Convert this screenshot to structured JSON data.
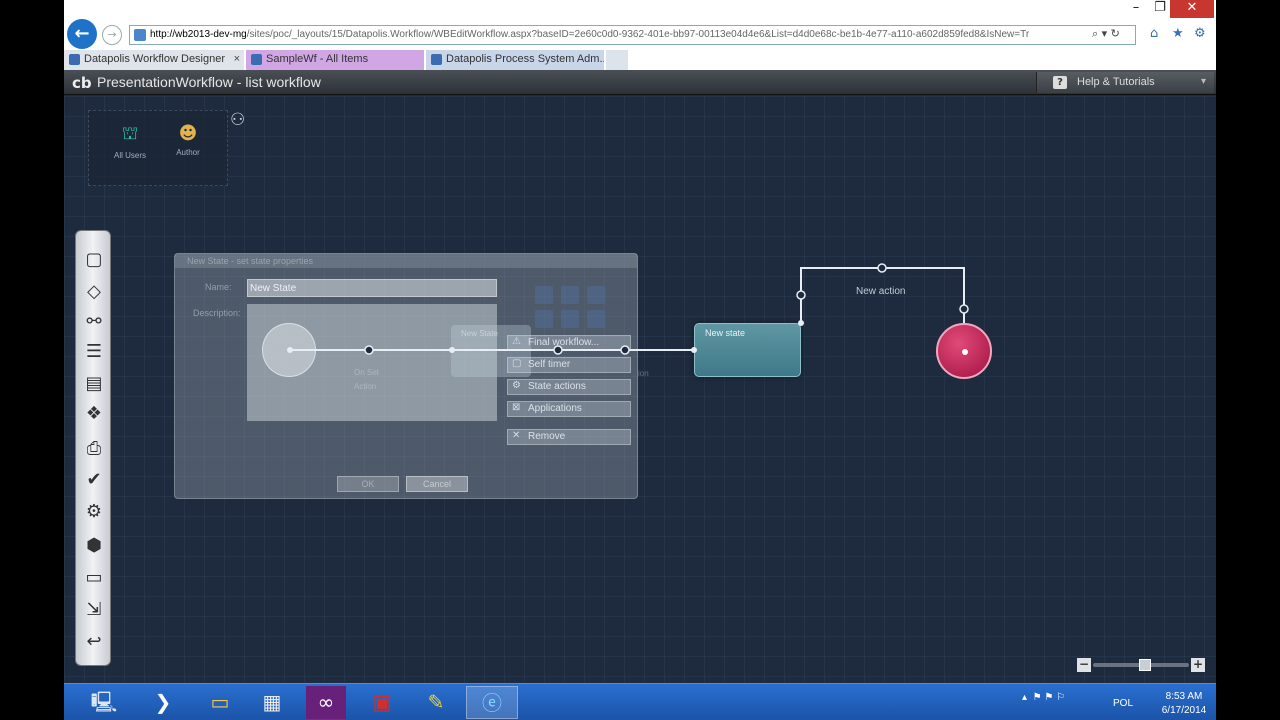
{
  "browser": {
    "address": {
      "host": "http://wb2013-dev-mg",
      "path": "/sites/poc/_layouts/15/Datapolis.Workflow/WBEditWorkflow.aspx?baseID=2e60c0d0-9362-401e-bb97-00113e04d4e6&List=d4d0e68c-be1b-4e77-a110-a602d859fed8&IsNew=Tr"
    },
    "tabs": [
      {
        "label": "Datapolis Workflow Designer",
        "close": "×"
      },
      {
        "label": "SampleWf - All Items"
      },
      {
        "label": "Datapolis Process System Adm..."
      }
    ],
    "window_buttons": {
      "minimize": "–",
      "restore": "❐",
      "close": "✕"
    }
  },
  "app": {
    "logo": "cb",
    "title": "PresentationWorkflow - list workflow",
    "help_button": "Help & Tutorials"
  },
  "roles": [
    {
      "label": "All Users",
      "icon": "users-icon"
    },
    {
      "label": "Author",
      "icon": "author-icon"
    }
  ],
  "toolbox": [
    "state-tool-icon",
    "decision-tool-icon",
    "connector-tool-icon",
    "list-tool-icon",
    "chart-tool-icon",
    "group-tool-icon",
    "print-tool-icon",
    "validate-tool-icon",
    "settings-tool-icon",
    "package-tool-icon",
    "save-tool-icon",
    "export-tool-icon",
    "undo-tool-icon"
  ],
  "dialog": {
    "title": "New State - set state properties",
    "name_label": "Name:",
    "name_value": "New State",
    "description_label": "Description:",
    "ok": "OK",
    "cancel": "Cancel"
  },
  "context_menu": [
    {
      "label": "Final workflow...",
      "icon": "final-icon"
    },
    {
      "label": "Self timer",
      "icon": "timer-icon"
    },
    {
      "label": "State actions",
      "icon": "state-actions-icon"
    },
    {
      "label": "Applications",
      "icon": "applications-icon"
    },
    {
      "label": "Remove",
      "icon": "remove-icon"
    }
  ],
  "diagram": {
    "ghost_state_label": "New State",
    "state_label": "New state",
    "action_label": "New action",
    "ghost_action_1": "On Set",
    "ghost_action_2": "Action",
    "ghost_tail": "ion"
  },
  "zoom": {
    "level": 0.55,
    "minus": "−",
    "plus": "+"
  },
  "taskbar": {
    "lang": "POL",
    "time": "8:53 AM",
    "date": "6/17/2014"
  }
}
